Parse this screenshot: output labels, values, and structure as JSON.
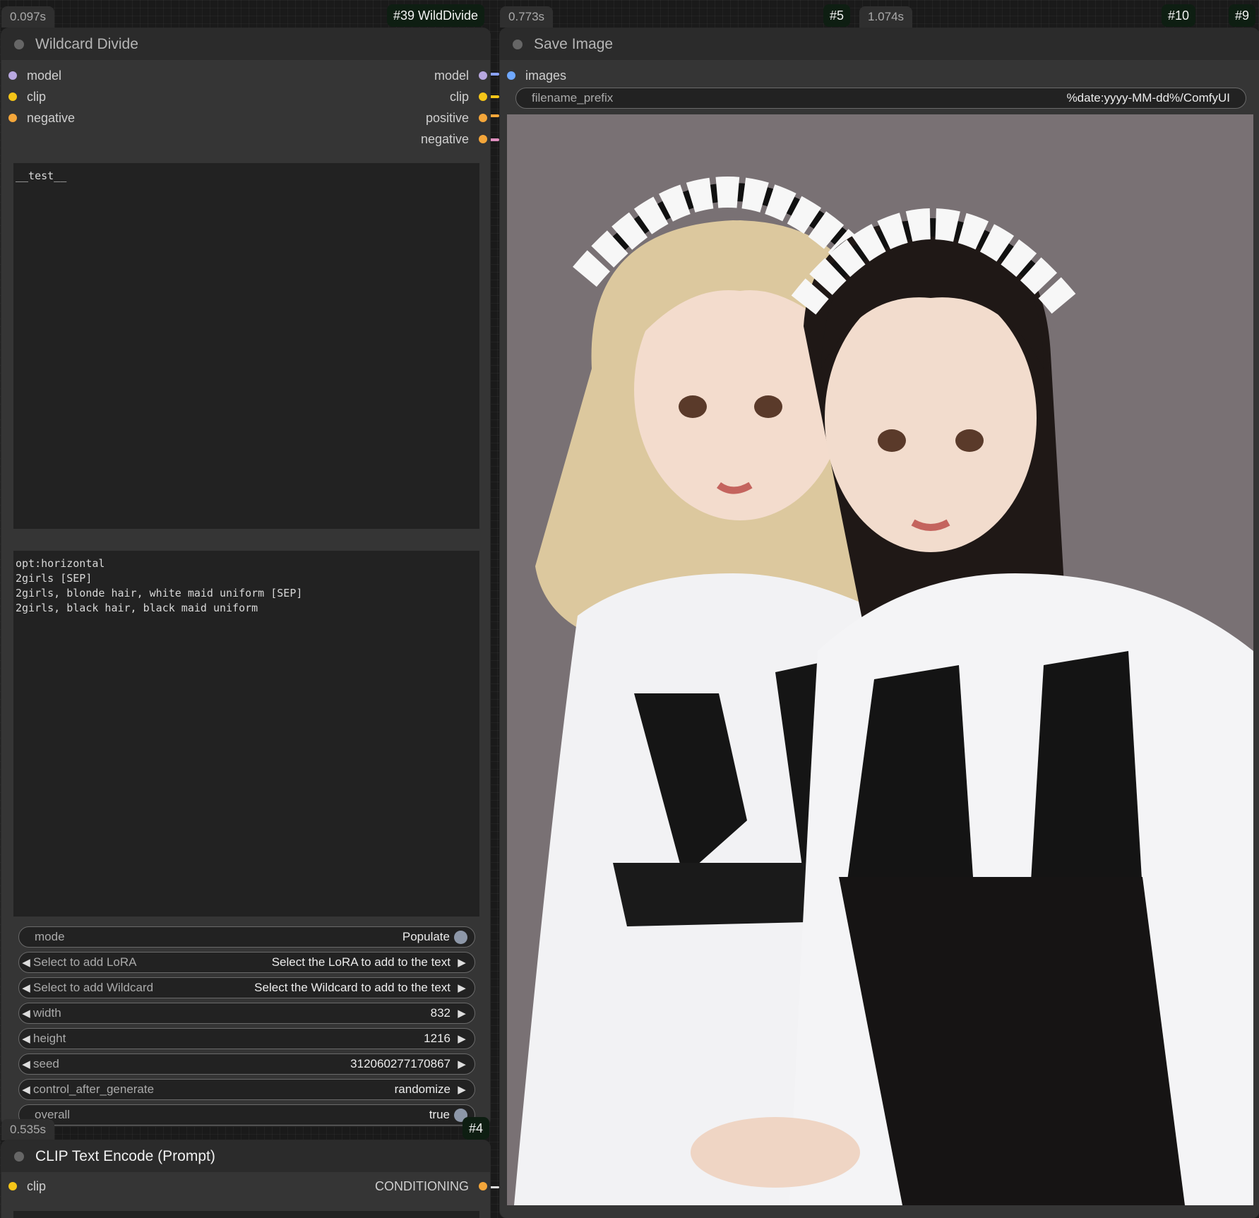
{
  "wildcard_divide": {
    "timing": "0.097s",
    "id_tag": "#39 WildDivide",
    "title": "Wildcard Divide",
    "inputs": [
      "model",
      "clip",
      "negative"
    ],
    "outputs": [
      "model",
      "clip",
      "positive",
      "negative"
    ],
    "wildcard_text": "__test__",
    "populated_text": "opt:horizontal\n2girls [SEP]\n2girls, blonde hair, white maid uniform [SEP]\n2girls, black hair, black maid uniform",
    "widgets": {
      "mode": {
        "label": "mode",
        "value": "Populate"
      },
      "lora": {
        "label": "Select to add LoRA",
        "value": "Select the LoRA to add to the text"
      },
      "wildcard": {
        "label": "Select to add Wildcard",
        "value": "Select the Wildcard to add to the text"
      },
      "width": {
        "label": "width",
        "value": "832"
      },
      "height": {
        "label": "height",
        "value": "1216"
      },
      "seed": {
        "label": "seed",
        "value": "312060277170867"
      },
      "control": {
        "label": "control_after_generate",
        "value": "randomize"
      },
      "overall": {
        "label": "overall",
        "value": "true"
      }
    }
  },
  "save_image": {
    "timing": "0.773s",
    "id_tag": "#5",
    "title": "Save Image",
    "input": "images",
    "filename_label": "filename_prefix",
    "filename_value": "%date:yyyy-MM-dd%/ComfyUI"
  },
  "other_badges": {
    "node10_timing": "1.074s",
    "node10_id": "#10",
    "node9_id": "#9"
  },
  "clip_encode": {
    "timing": "0.535s",
    "id_tag": "#4",
    "title": "CLIP Text Encode (Prompt)",
    "input": "clip",
    "output": "CONDITIONING"
  },
  "colors": {
    "model_socket": "#b8a8e0",
    "clip_socket": "#f5c518",
    "conditioning_socket": "#f4a63a",
    "image_socket": "#6fa8ff"
  }
}
